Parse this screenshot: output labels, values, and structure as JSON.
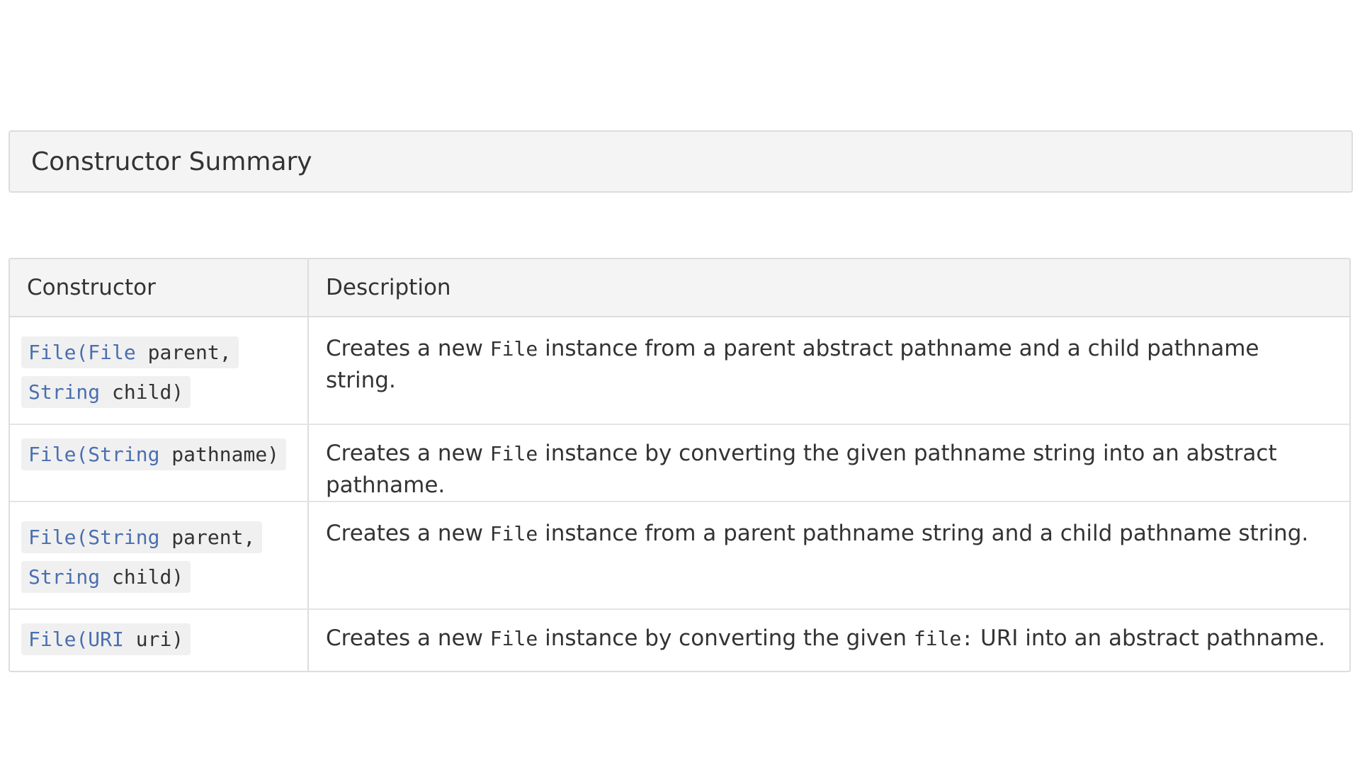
{
  "section": {
    "title": "Constructor Summary"
  },
  "table": {
    "headers": {
      "constructor": "Constructor",
      "description": "Description"
    },
    "rows": [
      {
        "signature": [
          {
            "text": "File",
            "kind": "type"
          },
          {
            "text": "(",
            "kind": "type"
          },
          {
            "text": "File",
            "kind": "type"
          },
          {
            "text": " parent,\n",
            "kind": "plain"
          },
          {
            "text": "String",
            "kind": "type"
          },
          {
            "text": " child)",
            "kind": "plain"
          }
        ],
        "description": [
          {
            "text": "Creates a new ",
            "code": false
          },
          {
            "text": "File",
            "code": true
          },
          {
            "text": " instance from a parent abstract pathname and a child pathname string.",
            "code": false
          }
        ]
      },
      {
        "signature": [
          {
            "text": "File",
            "kind": "type"
          },
          {
            "text": "(",
            "kind": "type"
          },
          {
            "text": "String",
            "kind": "type"
          },
          {
            "text": " pathname)",
            "kind": "plain"
          }
        ],
        "description": [
          {
            "text": "Creates a new ",
            "code": false
          },
          {
            "text": "File",
            "code": true
          },
          {
            "text": " instance by converting the given pathname string into an abstract pathname.",
            "code": false
          }
        ]
      },
      {
        "signature": [
          {
            "text": "File",
            "kind": "type"
          },
          {
            "text": "(",
            "kind": "type"
          },
          {
            "text": "String",
            "kind": "type"
          },
          {
            "text": " parent,\n",
            "kind": "plain"
          },
          {
            "text": "String",
            "kind": "type"
          },
          {
            "text": " child)",
            "kind": "plain"
          }
        ],
        "description": [
          {
            "text": "Creates a new ",
            "code": false
          },
          {
            "text": "File",
            "code": true
          },
          {
            "text": " instance from a parent pathname string and a child pathname string.",
            "code": false
          }
        ]
      },
      {
        "signature": [
          {
            "text": "File",
            "kind": "type"
          },
          {
            "text": "(",
            "kind": "type"
          },
          {
            "text": "URI",
            "kind": "type"
          },
          {
            "text": " uri)",
            "kind": "plain"
          }
        ],
        "description": [
          {
            "text": "Creates a new ",
            "code": false
          },
          {
            "text": "File",
            "code": true
          },
          {
            "text": " instance by converting the given ",
            "code": false
          },
          {
            "text": "file:",
            "code": true
          },
          {
            "text": " URI into an abstract pathname.",
            "code": false
          }
        ]
      }
    ]
  },
  "colors": {
    "link": "#4a6fb0",
    "text": "#333333",
    "header_bg": "#f4f4f4",
    "border": "#dddddd"
  }
}
